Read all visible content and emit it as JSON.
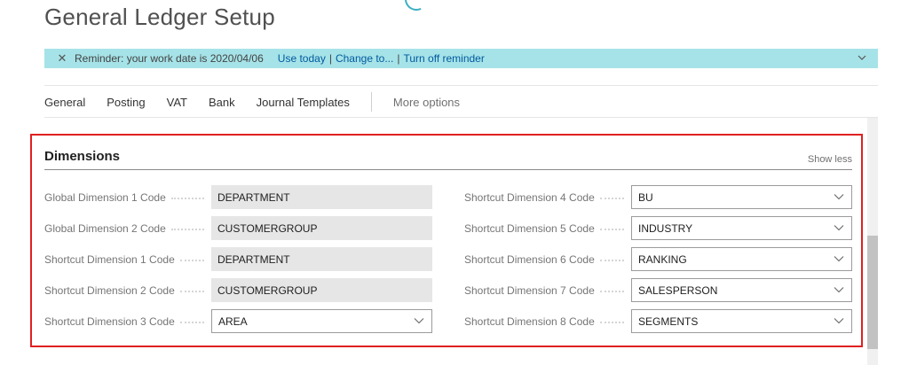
{
  "page": {
    "title": "General Ledger Setup"
  },
  "reminder": {
    "text": "Reminder: your work date is 2020/04/06",
    "use_today": "Use today",
    "change_to": "Change to...",
    "turn_off": "Turn off reminder",
    "separator": "|"
  },
  "actions": {
    "items": [
      "General",
      "Posting",
      "VAT",
      "Bank",
      "Journal Templates"
    ],
    "more": "More options"
  },
  "section": {
    "title": "Dimensions",
    "toggle": "Show less"
  },
  "fields_left": [
    {
      "label": "Global Dimension 1 Code",
      "value": "DEPARTMENT",
      "editable": false
    },
    {
      "label": "Global Dimension 2 Code",
      "value": "CUSTOMERGROUP",
      "editable": false
    },
    {
      "label": "Shortcut Dimension 1 Code",
      "value": "DEPARTMENT",
      "editable": false
    },
    {
      "label": "Shortcut Dimension 2 Code",
      "value": "CUSTOMERGROUP",
      "editable": false
    },
    {
      "label": "Shortcut Dimension 3 Code",
      "value": "AREA",
      "editable": true
    }
  ],
  "fields_right": [
    {
      "label": "Shortcut Dimension 4 Code",
      "value": "BU",
      "editable": true
    },
    {
      "label": "Shortcut Dimension 5 Code",
      "value": "INDUSTRY",
      "editable": true
    },
    {
      "label": "Shortcut Dimension 6 Code",
      "value": "RANKING",
      "editable": true
    },
    {
      "label": "Shortcut Dimension 7 Code",
      "value": "SALESPERSON",
      "editable": true
    },
    {
      "label": "Shortcut Dimension 8 Code",
      "value": "SEGMENTS",
      "editable": true
    }
  ],
  "icons": {
    "reminder_close": "close-icon",
    "reminder_expand": "chevron-down-icon",
    "dropdown": "chevron-down-icon"
  },
  "colors": {
    "reminder_bg": "#a6e3e8",
    "link": "#005a9e",
    "highlight": "#e02020",
    "readonly_bg": "#e6e6e6"
  }
}
